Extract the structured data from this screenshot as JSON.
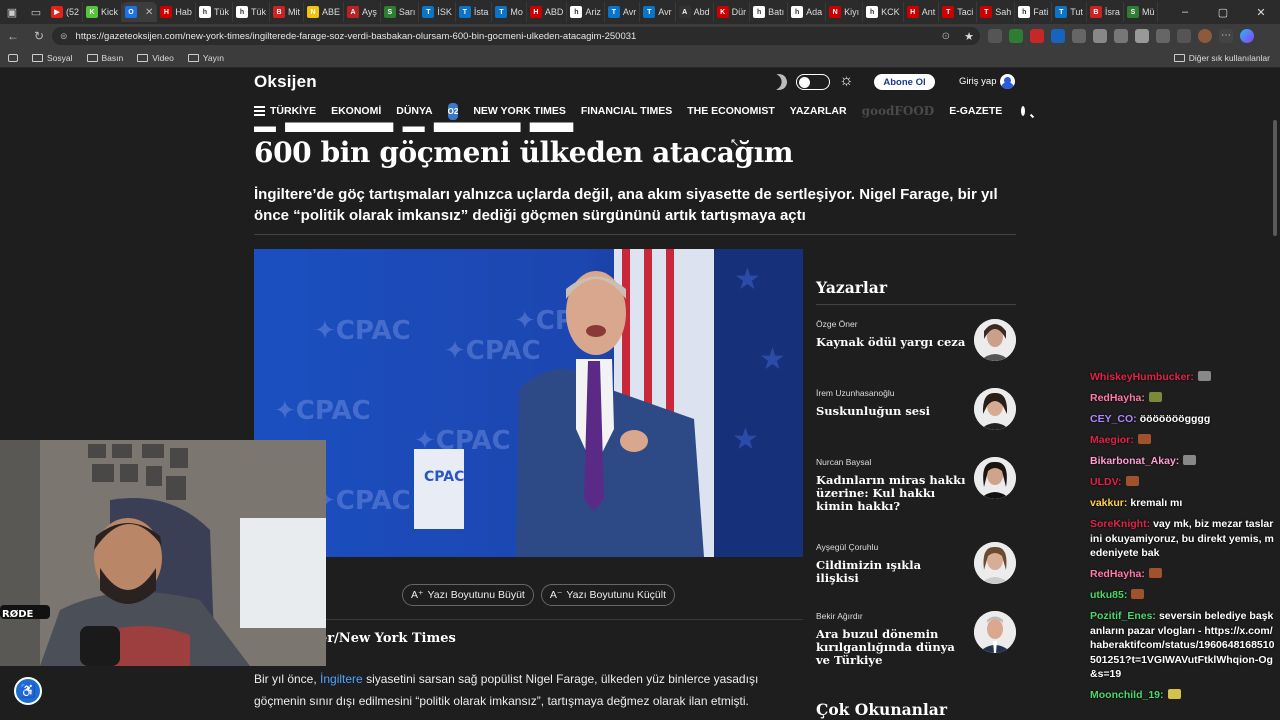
{
  "browser": {
    "tabs": [
      {
        "label": "(52",
        "color": "#e62117",
        "glyph": "▶"
      },
      {
        "label": "Kick",
        "color": "#53c639",
        "glyph": "K"
      },
      {
        "label": "",
        "color": "#1a73e8",
        "glyph": "O"
      },
      {
        "label": "Hab",
        "color": "#c00",
        "glyph": "H"
      },
      {
        "label": "Tük",
        "color": "#fff",
        "glyph": "h"
      },
      {
        "label": "Tük",
        "color": "#fff",
        "glyph": "h"
      },
      {
        "label": "Mit",
        "color": "#c22",
        "glyph": "B"
      },
      {
        "label": "ABE",
        "color": "#f1c40f",
        "glyph": "N"
      },
      {
        "label": "Ayş",
        "color": "#b22",
        "glyph": "A"
      },
      {
        "label": "Sarı",
        "color": "#2e7d32",
        "glyph": "S"
      },
      {
        "label": "İSK",
        "color": "#0a74c9",
        "glyph": "T"
      },
      {
        "label": "İsta",
        "color": "#0a74c9",
        "glyph": "T"
      },
      {
        "label": "Mo",
        "color": "#0a74c9",
        "glyph": "T"
      },
      {
        "label": "ABD",
        "color": "#c00",
        "glyph": "H"
      },
      {
        "label": "Ariz",
        "color": "#fff",
        "glyph": "h"
      },
      {
        "label": "Avr",
        "color": "#0a74c9",
        "glyph": "T"
      },
      {
        "label": "Avr",
        "color": "#0a74c9",
        "glyph": "T"
      },
      {
        "label": "Abd",
        "color": "#333",
        "glyph": "A"
      },
      {
        "label": "Dür",
        "color": "#c00",
        "glyph": "K"
      },
      {
        "label": "Batı",
        "color": "#fff",
        "glyph": "h"
      },
      {
        "label": "Ada",
        "color": "#fff",
        "glyph": "h"
      },
      {
        "label": "Kiyı",
        "color": "#c00",
        "glyph": "N"
      },
      {
        "label": "KCK",
        "color": "#fff",
        "glyph": "h"
      },
      {
        "label": "Ant",
        "color": "#c00",
        "glyph": "H"
      },
      {
        "label": "Taci",
        "color": "#c00",
        "glyph": "T"
      },
      {
        "label": "Sah",
        "color": "#c00",
        "glyph": "T"
      },
      {
        "label": "Fati",
        "color": "#fff",
        "glyph": "h"
      },
      {
        "label": "Tut",
        "color": "#0a74c9",
        "glyph": "T"
      },
      {
        "label": "İsra",
        "color": "#c22",
        "glyph": "B"
      },
      {
        "label": "Mü",
        "color": "#2e7d32",
        "glyph": "S"
      }
    ],
    "url": "https://gazeteoksijen.com/new-york-times/ingilterede-farage-soz-verdi-basbakan-olursam-600-bin-gocmeni-ulkeden-atacagim-250031",
    "bookmarks": [
      "Sosyal",
      "Basın",
      "Video",
      "Yayın"
    ],
    "other_bookmarks": "Diğer sık kullanılanlar"
  },
  "site": {
    "logo": "Oksijen",
    "subscribe": "Abone Ol",
    "login": "Giriş yap",
    "nav": [
      "TÜRKİYE",
      "EKONOMİ",
      "DÜNYA"
    ],
    "nav_badge": "O2",
    "nav2": [
      "NEW YORK TIMES",
      "FINANCIAL TIMES",
      "THE ECONOMIST",
      "YAZARLAR"
    ],
    "nav_brand": "goodFOOD",
    "nav_last": "E-GAZETE"
  },
  "article": {
    "headline_line2": "600 bin göçmeni ülkeden atacağım",
    "spot": "İngiltere’de göç tartışmaları yalnızca uçlarda değil, ana akım siyasette de sertleşiyor. Nigel Farage, bir yıl önce “politik olarak imkansız” dediği göçmen sürgününü artık tartışmaya açtı",
    "font_up": "Yazı Boyutunu Büyüt",
    "font_down": "Yazı Boyutunu Küçült",
    "byline": "ler/New York Times",
    "body_pre": "Bir yıl önce, ",
    "body_link": "İngiltere",
    "body_post": " siyasetini sarsan sağ popülist Nigel Farage, ülkeden yüz binlerce yasadışı göçmenin sınır dışı edilmesini “politik olarak imkansız”, tartışmaya değmez olarak ilan etmişti."
  },
  "sidebar": {
    "title": "Yazarlar",
    "authors": [
      {
        "name": "Özge Öner",
        "title": "Kaynak ödül yargı ceza"
      },
      {
        "name": "İrem Uzunhasanoğlu",
        "title": "Suskunluğun sesi"
      },
      {
        "name": "Nurcan Baysal",
        "title": "Kadınların miras hakkı üzerine: Kul hakkı kimin hakkı?"
      },
      {
        "name": "Ayşegül Çoruhlu",
        "title": "Cildimizin ışıkla ilişkisi"
      },
      {
        "name": "Bekir Ağırdır",
        "title": "Ara buzul dönemin kırılganlığında dünya ve Türkiye"
      }
    ],
    "most_read": "Çok Okunanlar"
  },
  "chat": [
    {
      "user": "WhiskeyHumbucker:",
      "color": "#e0224a",
      "text": "",
      "emote": "#888"
    },
    {
      "user": "RedHayha:",
      "color": "#ff7aa8",
      "text": "",
      "emote": "#7a8a3a"
    },
    {
      "user": "CEY_CO:",
      "color": "#b084ff",
      "text": "ööööööögggg",
      "emote": ""
    },
    {
      "user": "Maegior:",
      "color": "#e0224a",
      "text": "",
      "emote": "#a0522d"
    },
    {
      "user": "Bikarbonat_Akay:",
      "color": "#ff9ed0",
      "text": "",
      "emote": "#888"
    },
    {
      "user": "ULDV:",
      "color": "#e0224a",
      "text": "",
      "emote": "#a0522d"
    },
    {
      "user": "vakkur:",
      "color": "#ffd24a",
      "text": "kremalı mı",
      "emote": ""
    },
    {
      "user": "SoreKnight:",
      "color": "#e0224a",
      "text": "vay mk, biz mezar taslarini okuyamiyoruz, bu direkt yemis, medeniyete bak",
      "emote": ""
    },
    {
      "user": "RedHayha:",
      "color": "#ff7aa8",
      "text": "",
      "emote": "#a0522d"
    },
    {
      "user": "utku85:",
      "color": "#4ad66d",
      "text": "",
      "emote": "#a0522d"
    },
    {
      "user": "Pozitif_Enes:",
      "color": "#4ad66d",
      "text": "seversin belediye başkanların pazar vlogları - https://x.com/haberaktifcom/status/1960648168510501251?t=1VGIWAVutFtklWhqion-Og&s=19",
      "emote": ""
    },
    {
      "user": "Moonchild_19:",
      "color": "#4ad66d",
      "text": "",
      "emote": "#d4c24a"
    }
  ]
}
